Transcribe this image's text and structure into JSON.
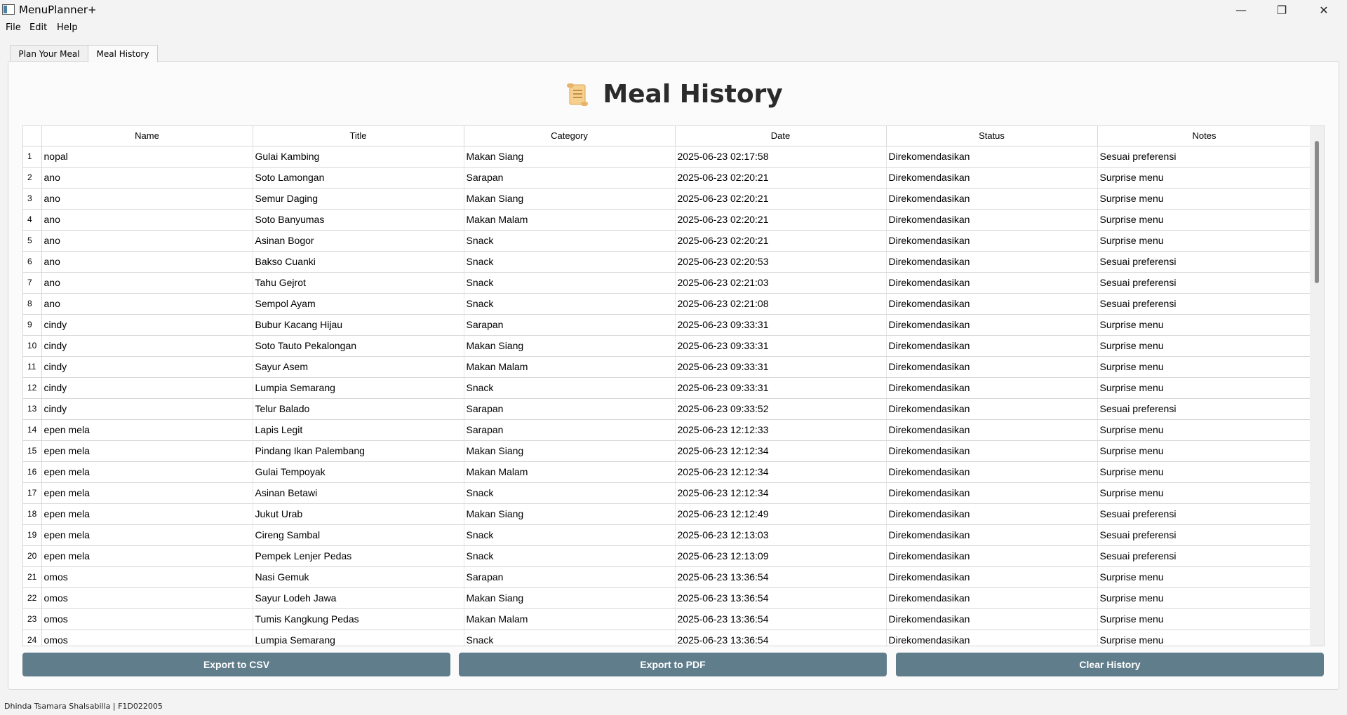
{
  "window": {
    "title": "MenuPlanner+"
  },
  "menu": [
    "File",
    "Edit",
    "Help"
  ],
  "tabs": [
    {
      "label": "Plan Your Meal",
      "active": false
    },
    {
      "label": "Meal History",
      "active": true
    }
  ],
  "page": {
    "title": "Meal History",
    "icon": "scroll-icon"
  },
  "table": {
    "columns": [
      "Name",
      "Title",
      "Category",
      "Date",
      "Status",
      "Notes"
    ],
    "rows": [
      [
        "1",
        "nopal",
        "Gulai Kambing",
        "Makan Siang",
        "2025-06-23 02:17:58",
        "Direkomendasikan",
        "Sesuai preferensi"
      ],
      [
        "2",
        "ano",
        "Soto Lamongan",
        "Sarapan",
        "2025-06-23 02:20:21",
        "Direkomendasikan",
        "Surprise menu"
      ],
      [
        "3",
        "ano",
        "Semur Daging",
        "Makan Siang",
        "2025-06-23 02:20:21",
        "Direkomendasikan",
        "Surprise menu"
      ],
      [
        "4",
        "ano",
        "Soto Banyumas",
        "Makan Malam",
        "2025-06-23 02:20:21",
        "Direkomendasikan",
        "Surprise menu"
      ],
      [
        "5",
        "ano",
        "Asinan Bogor",
        "Snack",
        "2025-06-23 02:20:21",
        "Direkomendasikan",
        "Surprise menu"
      ],
      [
        "6",
        "ano",
        "Bakso Cuanki",
        "Snack",
        "2025-06-23 02:20:53",
        "Direkomendasikan",
        "Sesuai preferensi"
      ],
      [
        "7",
        "ano",
        "Tahu Gejrot",
        "Snack",
        "2025-06-23 02:21:03",
        "Direkomendasikan",
        "Sesuai preferensi"
      ],
      [
        "8",
        "ano",
        "Sempol Ayam",
        "Snack",
        "2025-06-23 02:21:08",
        "Direkomendasikan",
        "Sesuai preferensi"
      ],
      [
        "9",
        "cindy",
        "Bubur Kacang Hijau",
        "Sarapan",
        "2025-06-23 09:33:31",
        "Direkomendasikan",
        "Surprise menu"
      ],
      [
        "10",
        "cindy",
        "Soto Tauto Pekalongan",
        "Makan Siang",
        "2025-06-23 09:33:31",
        "Direkomendasikan",
        "Surprise menu"
      ],
      [
        "11",
        "cindy",
        "Sayur Asem",
        "Makan Malam",
        "2025-06-23 09:33:31",
        "Direkomendasikan",
        "Surprise menu"
      ],
      [
        "12",
        "cindy",
        "Lumpia Semarang",
        "Snack",
        "2025-06-23 09:33:31",
        "Direkomendasikan",
        "Surprise menu"
      ],
      [
        "13",
        "cindy",
        "Telur Balado",
        "Sarapan",
        "2025-06-23 09:33:52",
        "Direkomendasikan",
        "Sesuai preferensi"
      ],
      [
        "14",
        "epen mela",
        "Lapis Legit",
        "Sarapan",
        "2025-06-23 12:12:33",
        "Direkomendasikan",
        "Surprise menu"
      ],
      [
        "15",
        "epen mela",
        "Pindang Ikan Palembang",
        "Makan Siang",
        "2025-06-23 12:12:34",
        "Direkomendasikan",
        "Surprise menu"
      ],
      [
        "16",
        "epen mela",
        "Gulai Tempoyak",
        "Makan Malam",
        "2025-06-23 12:12:34",
        "Direkomendasikan",
        "Surprise menu"
      ],
      [
        "17",
        "epen mela",
        "Asinan Betawi",
        "Snack",
        "2025-06-23 12:12:34",
        "Direkomendasikan",
        "Surprise menu"
      ],
      [
        "18",
        "epen mela",
        "Jukut Urab",
        "Makan Siang",
        "2025-06-23 12:12:49",
        "Direkomendasikan",
        "Sesuai preferensi"
      ],
      [
        "19",
        "epen mela",
        "Cireng Sambal",
        "Snack",
        "2025-06-23 12:13:03",
        "Direkomendasikan",
        "Sesuai preferensi"
      ],
      [
        "20",
        "epen mela",
        "Pempek Lenjer Pedas",
        "Snack",
        "2025-06-23 12:13:09",
        "Direkomendasikan",
        "Sesuai preferensi"
      ],
      [
        "21",
        "omos",
        "Nasi Gemuk",
        "Sarapan",
        "2025-06-23 13:36:54",
        "Direkomendasikan",
        "Surprise menu"
      ],
      [
        "22",
        "omos",
        "Sayur Lodeh Jawa",
        "Makan Siang",
        "2025-06-23 13:36:54",
        "Direkomendasikan",
        "Surprise menu"
      ],
      [
        "23",
        "omos",
        "Tumis Kangkung Pedas",
        "Makan Malam",
        "2025-06-23 13:36:54",
        "Direkomendasikan",
        "Surprise menu"
      ],
      [
        "24",
        "omos",
        "Lumpia Semarang",
        "Snack",
        "2025-06-23 13:36:54",
        "Direkomendasikan",
        "Surprise menu"
      ]
    ]
  },
  "buttons": {
    "export_csv": "Export to CSV",
    "export_pdf": "Export to PDF",
    "clear_history": "Clear History",
    "color": "#607d8b"
  },
  "status_bar": {
    "text": "Dhinda Tsamara Shalsabilla | F1D022005"
  }
}
